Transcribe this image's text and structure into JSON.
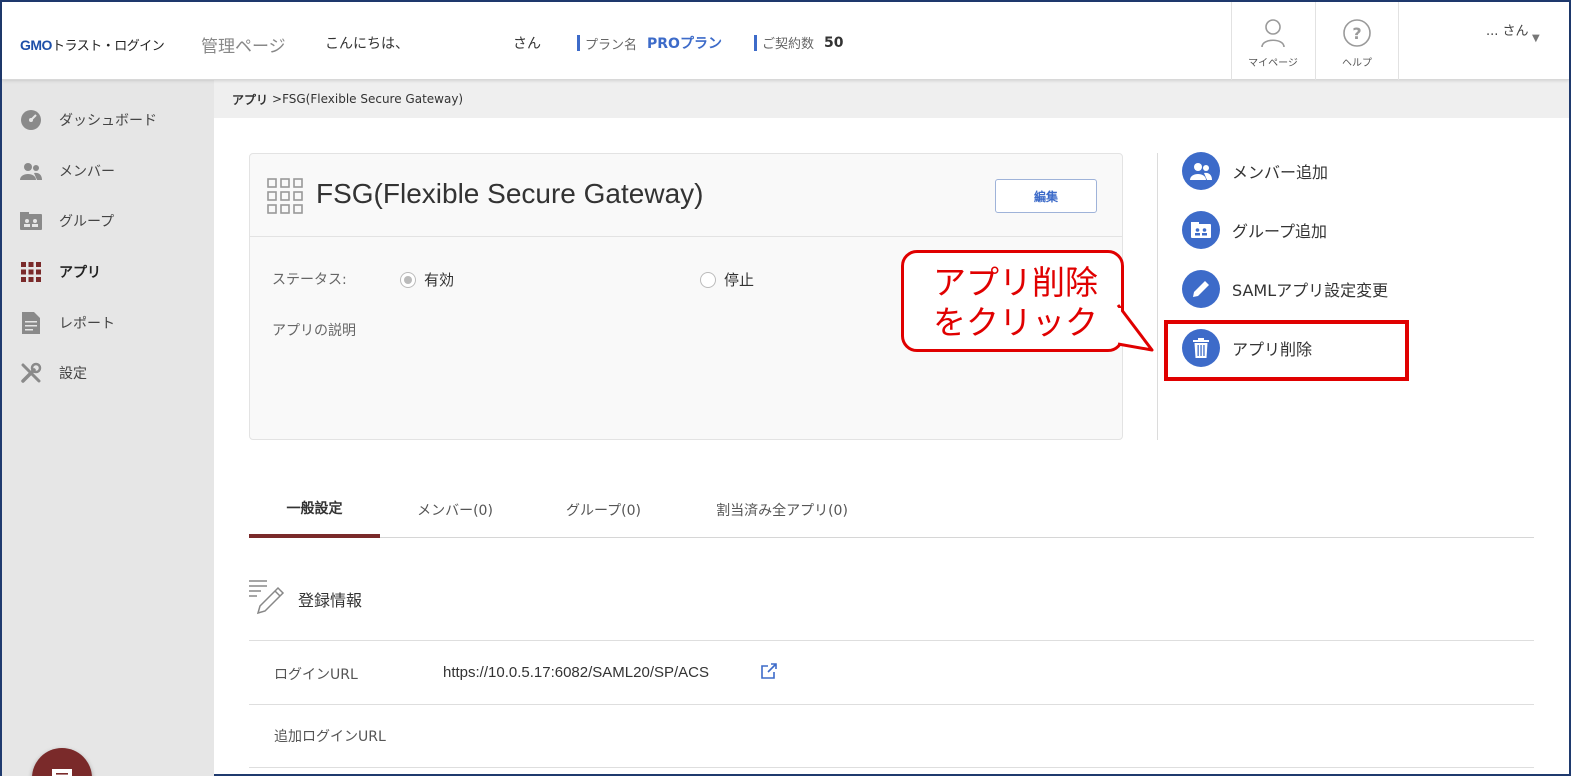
{
  "header": {
    "logo_brand": "GMO",
    "logo_rest": "トラスト・ログイン",
    "admin_title": "管理ページ",
    "greeting": "こんにちは、",
    "greeting_suffix": "さん",
    "plan_label": "プラン名",
    "plan_value": "PROプラン",
    "contract_label": "ご契約数",
    "contract_value": "50",
    "mypage_label": "マイページ",
    "help_label": "ヘルプ",
    "user_label": "... さん",
    "user_caret": "▼"
  },
  "sidebar": {
    "items": [
      {
        "label": "ダッシュボード",
        "icon": "dashboard-icon"
      },
      {
        "label": "メンバー",
        "icon": "members-icon"
      },
      {
        "label": "グループ",
        "icon": "group-icon"
      },
      {
        "label": "アプリ",
        "icon": "apps-grid-icon",
        "active": true
      },
      {
        "label": "レポート",
        "icon": "report-icon"
      },
      {
        "label": "設定",
        "icon": "settings-tools-icon"
      }
    ]
  },
  "breadcrumb": {
    "root": "アプリ",
    "current": ">FSG(Flexible Secure Gateway)"
  },
  "app_card": {
    "title": "FSG(Flexible Secure Gateway)",
    "edit_label": "編集",
    "status_label": "ステータス:",
    "status_options": [
      {
        "label": "有効",
        "selected": true
      },
      {
        "label": "停止",
        "selected": false
      }
    ],
    "description_label": "アプリの説明"
  },
  "callout": {
    "line1": "アプリ削除",
    "line2": "をクリック",
    "color": "#e00000"
  },
  "actions": [
    {
      "label": "メンバー追加",
      "icon": "add-member-icon"
    },
    {
      "label": "グループ追加",
      "icon": "add-group-icon"
    },
    {
      "label": "SAMLアプリ設定変更",
      "icon": "pencil-icon"
    },
    {
      "label": "アプリ削除",
      "icon": "trash-icon"
    }
  ],
  "tabs": [
    {
      "label": "一般設定",
      "active": true
    },
    {
      "label": "メンバー(0)"
    },
    {
      "label": "グループ(0)"
    },
    {
      "label": "割当済み全アプリ(0)"
    }
  ],
  "registration": {
    "title": "登録情報",
    "rows": [
      {
        "label": "ログインURL",
        "value": "https://10.0.5.17:6082/SAML20/SP/ACS"
      },
      {
        "label": "追加ログインURL",
        "value": ""
      }
    ]
  },
  "colors": {
    "accent_blue": "#3d6bc9",
    "tab_underline": "#7a2a2a",
    "annotation_red": "#e00000"
  }
}
